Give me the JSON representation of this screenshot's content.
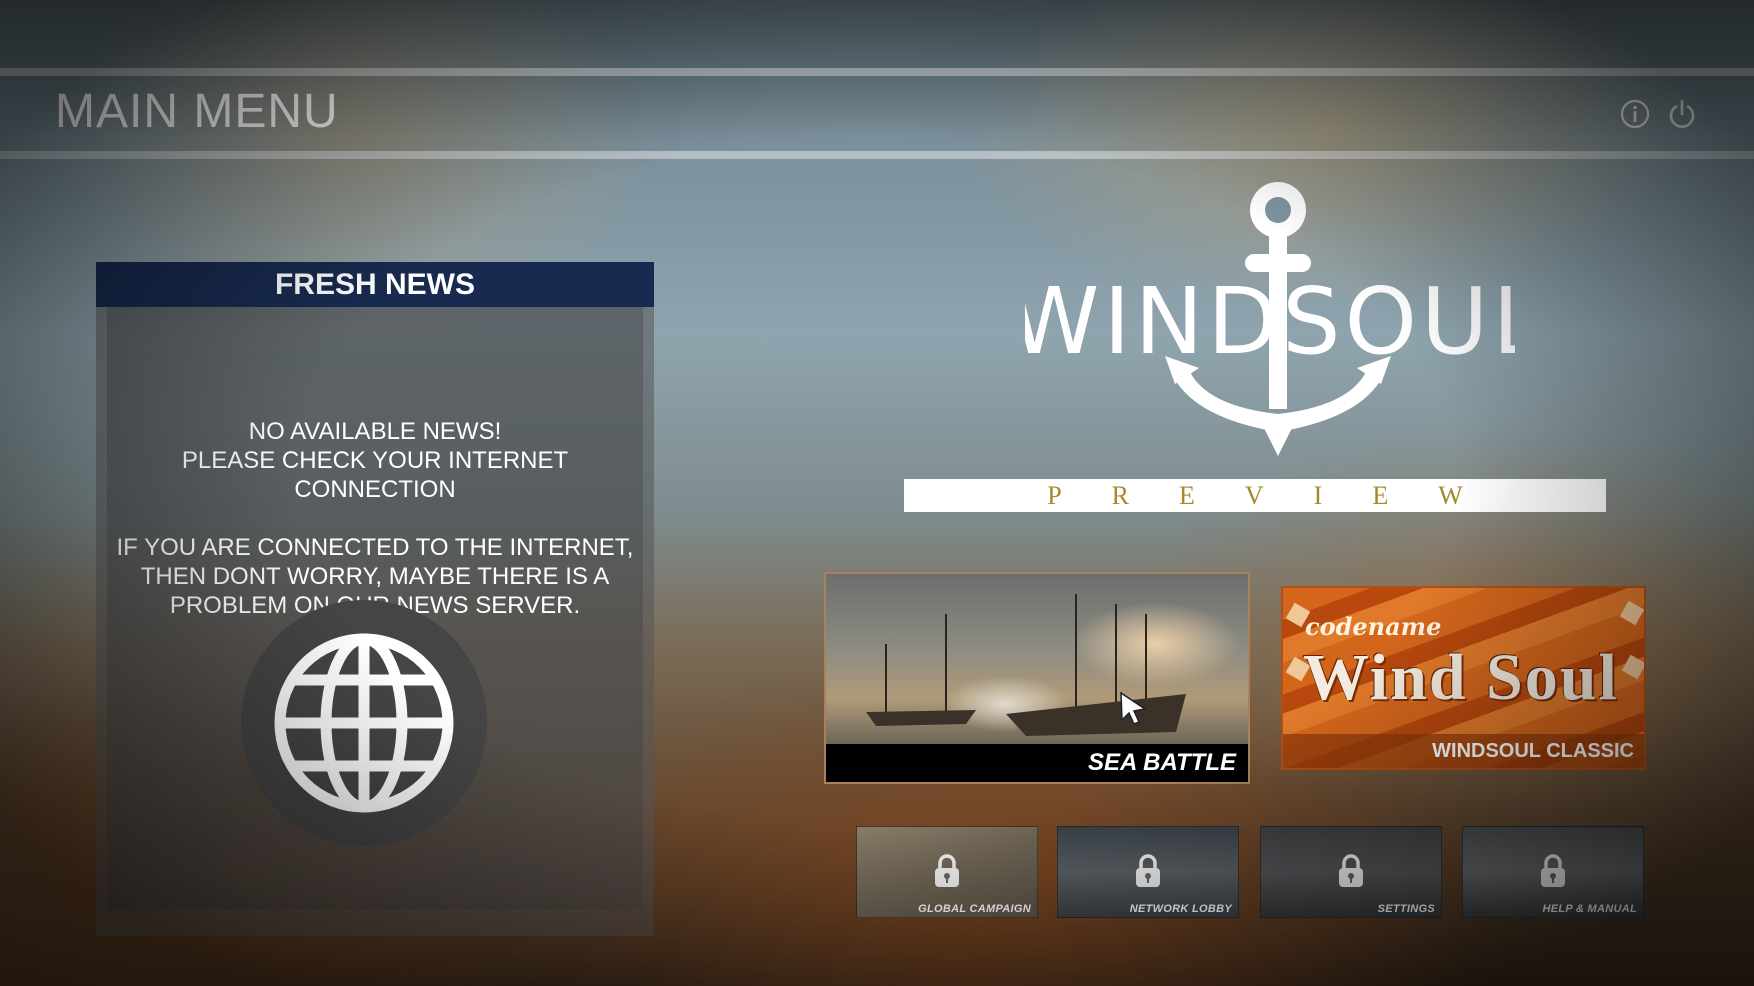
{
  "header": {
    "title": "MAIN MENU",
    "icons": [
      "info-icon",
      "power-icon"
    ]
  },
  "news": {
    "title": "FRESH NEWS",
    "lines": [
      "NO AVAILABLE NEWS!",
      "PLEASE CHECK YOUR INTERNET CONNECTION",
      "IF YOU ARE CONNECTED TO THE INTERNET,",
      "THEN DONT WORRY, MAYBE THERE IS A",
      "PROBLEM ON OUR NEWS SERVER."
    ],
    "icon": "globe-icon"
  },
  "logo": {
    "wordmark": "WINDSOUL",
    "subtitle": "PREVIEW"
  },
  "modes": {
    "sea_battle": "SEA BATTLE",
    "classic": {
      "codename": "codename",
      "wordmark": "Wind Soul",
      "label": "WINDSOUL CLASSIC"
    }
  },
  "locked_tiles": [
    {
      "label": "GLOBAL CAMPAIGN",
      "icon": "lock-icon"
    },
    {
      "label": "NETWORK LOBBY",
      "icon": "lock-icon"
    },
    {
      "label": "SETTINGS",
      "icon": "lock-icon"
    },
    {
      "label": "HELP & MANUAL",
      "icon": "lock-icon"
    }
  ],
  "colors": {
    "news_header": "#182a4f",
    "preview_text": "#a58a2c",
    "classic_orange": "#d4661c"
  }
}
